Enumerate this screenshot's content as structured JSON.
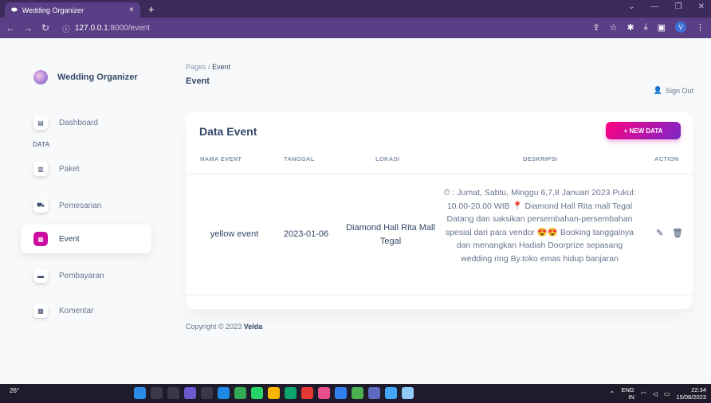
{
  "browser": {
    "tab_title": "Wedding Organizer",
    "tab_close": "×",
    "new_tab": "+",
    "url_host": "127.0.0.1",
    "url_path": ":8000/event"
  },
  "brand": {
    "name": "Wedding Organizer"
  },
  "sidebar": {
    "section_label": "DATA",
    "items": [
      {
        "label": "Dashboard",
        "icon": "dashboard-icon"
      },
      {
        "label": "Paket",
        "icon": "package-icon"
      },
      {
        "label": "Pemesanan",
        "icon": "cart-icon"
      },
      {
        "label": "Event",
        "icon": "calendar-icon"
      },
      {
        "label": "Pembayaran",
        "icon": "payment-icon"
      },
      {
        "label": "Komentar",
        "icon": "comment-icon"
      }
    ]
  },
  "header": {
    "breadcrumb_root": "Pages",
    "breadcrumb_sep": "/",
    "breadcrumb_current": "Event",
    "title": "Event",
    "signout": "Sign Out"
  },
  "card": {
    "title": "Data Event",
    "new_button": "+ NEW DATA",
    "columns": [
      "NAMA EVENT",
      "TANGGAL",
      "LOKASI",
      "DESKRIPSI",
      "ACTION"
    ],
    "rows": [
      {
        "nama_event": "yellow event",
        "tanggal": "2023-01-06",
        "lokasi": "Diamond Hall Rita Mall Tegal",
        "deskripsi": "⏱ : Jumat, Sabtu, Minggu 6,7,8 Januari 2023 Pukul: 10.00-20.00 WIB 📍 Diamond Hall Rita mall Tegal Datang dan saksikan persembahan-persembahan spesial dari para vendor 😍😍 Booking tanggalnya dan menangkan Hadiah Doorprize sepasang wedding ring By.toko emas hidup banjaran"
      }
    ]
  },
  "footer": {
    "copyright_prefix": "Copyright © 2023",
    "copyright_name": "Velda"
  },
  "taskbar": {
    "weather": "26°",
    "lang": "ENG",
    "lang_sub": "IN",
    "time": "22:34",
    "date": "15/08/2023"
  }
}
